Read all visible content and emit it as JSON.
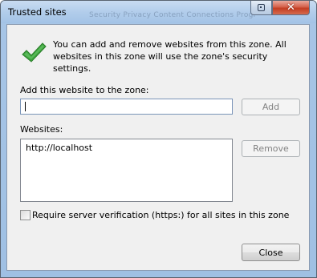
{
  "window": {
    "title": "Trusted sites",
    "background_title_text": "Security  Privacy  Content  Connections  Progr"
  },
  "info": {
    "text": "You can add and remove websites from this zone. All websites in this zone will use the zone's security settings.",
    "icon": "green-checkmark-icon"
  },
  "add_site": {
    "label": "Add this website to the zone:",
    "value": "",
    "button_label": "Add"
  },
  "websites": {
    "label": "Websites:",
    "items": [
      "http://localhost"
    ],
    "remove_label": "Remove"
  },
  "verification": {
    "label": "Require server verification (https:) for all sites in this zone",
    "checked": false
  },
  "footer": {
    "close_label": "Close"
  },
  "colors": {
    "frame": "#a7c5e6",
    "close_button": "#c43d22",
    "checkmark": "#3da33d",
    "dialog_bg": "#f0f0f0"
  }
}
